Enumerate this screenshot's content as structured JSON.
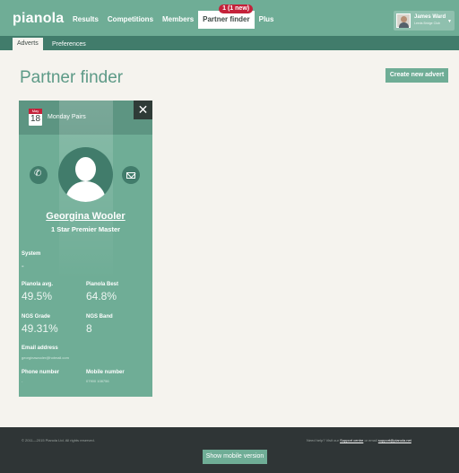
{
  "header": {
    "logo": "pianola",
    "nav": [
      {
        "label": "Results"
      },
      {
        "label": "Competitions"
      },
      {
        "label": "Members"
      },
      {
        "label": "Partner finder",
        "badge": "1 (1 new)"
      },
      {
        "label": "Plus"
      }
    ],
    "user": {
      "name": "James Ward",
      "club": "Leeds Bridge Club"
    }
  },
  "subnav": {
    "tabs": [
      {
        "label": "Adverts"
      },
      {
        "label": "Preferences"
      }
    ]
  },
  "page": {
    "title": "Partner finder",
    "create_button": "Create new advert"
  },
  "advert": {
    "calendar": {
      "month": "May",
      "day": "18"
    },
    "event": "Monday Pairs",
    "close": "✕",
    "name": "Georgina Wooler",
    "rank": "1 Star Premier Master",
    "system": {
      "label": "System",
      "value": "-"
    },
    "pianola_avg": {
      "label": "Pianola avg.",
      "value": "49.5%"
    },
    "pianola_best": {
      "label": "Pianola Best",
      "value": "64.8%"
    },
    "ngs_grade": {
      "label": "NGS Grade",
      "value": "49.31%"
    },
    "ngs_band": {
      "label": "NGS Band",
      "value": "8"
    },
    "email": {
      "label": "Email address",
      "value": "georginawooler@hotmail.com"
    },
    "phone": {
      "label": "Phone number",
      "value": "-"
    },
    "mobile": {
      "label": "Mobile number",
      "value": "07900 108756"
    }
  },
  "footer": {
    "copyright": "© 2011—2015 Pianola Ltd. All rights reserved.",
    "help_prefix": "Need help? Visit our",
    "support_link": "Support centre",
    "help_middle": "or email",
    "email_link": "support@pianola.net",
    "mobile_button": "Show mobile version"
  }
}
